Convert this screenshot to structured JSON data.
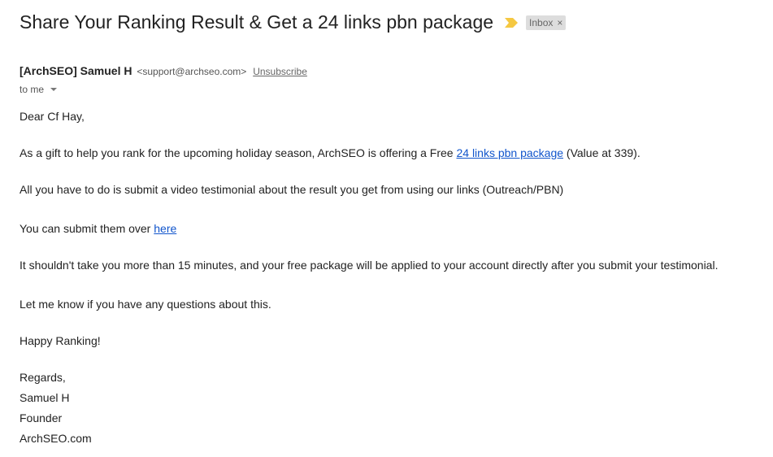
{
  "email": {
    "subject": "Share Your Ranking Result & Get a 24 links pbn package",
    "label": "Inbox",
    "label_close": "×",
    "sender_name": "[ArchSEO] Samuel H",
    "sender_email": "<support@archseo.com>",
    "unsubscribe": "Unsubscribe",
    "recipient": "to me"
  },
  "body": {
    "greeting": "Dear Cf Hay,",
    "p1_before": "As a gift to help you rank for the upcoming holiday season, ArchSEO is offering a Free ",
    "p1_link": "24 links pbn package",
    "p1_after": " (Value at 339).",
    "p2": "All you have to do is submit a video testimonial about the result you get from using our links (Outreach/PBN)",
    "p3_before": "You can submit them over ",
    "p3_link": "here",
    "p4": "It shouldn't take you more than 15 minutes, and your free package will be applied to your account directly after you submit your testimonial.",
    "p5": "Let me know if you have any questions about this.",
    "p6": "Happy Ranking!",
    "sign_regards": "Regards,",
    "sign_name": "Samuel H",
    "sign_title": "Founder",
    "sign_site": "ArchSEO.com"
  },
  "colors": {
    "importance_marker": "#f5c842",
    "link": "#1155cc",
    "chip_bg": "#dddddd"
  },
  "icons": {
    "importance": "importance-marker-icon",
    "caret": "chevron-down-icon"
  }
}
